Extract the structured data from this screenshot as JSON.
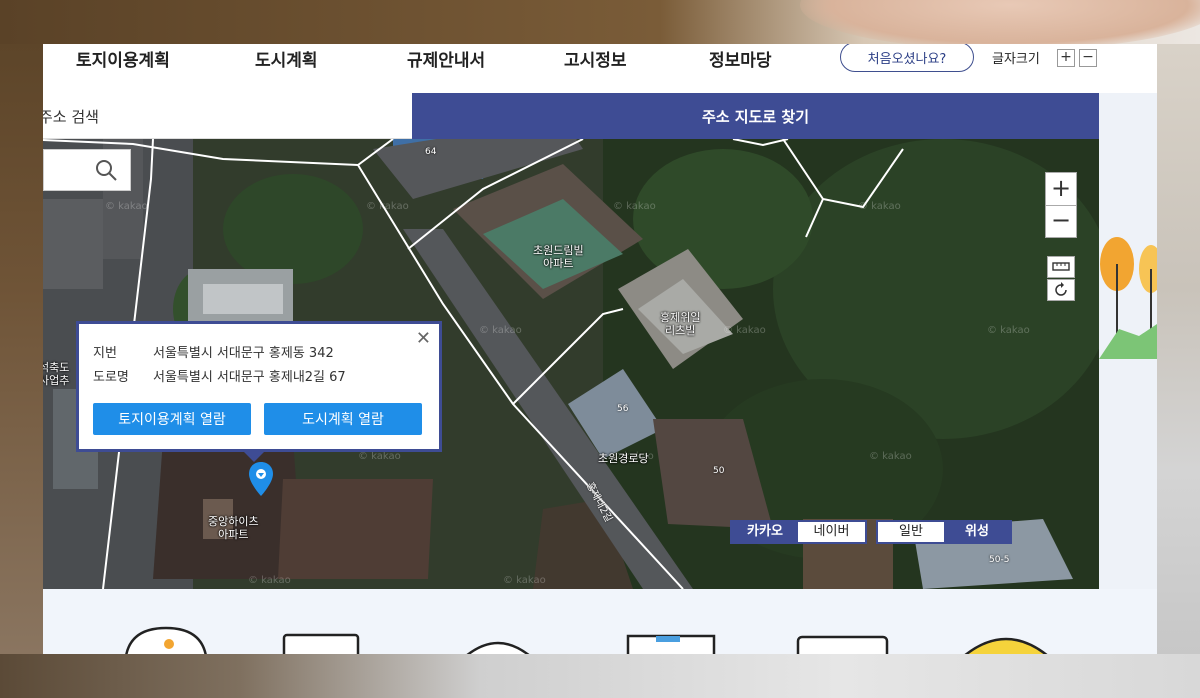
{
  "nav": {
    "items": [
      "토지이용계획",
      "도시계획",
      "규제안내서",
      "고시정보",
      "정보마당"
    ],
    "first_visit": "처음오셨나요?",
    "font_size_label": "글자크기",
    "font_plus": "+",
    "font_minus": "−"
  },
  "tabs": {
    "address_search": "주소 검색",
    "map_find": "주소 지도로 찾기"
  },
  "map": {
    "watermark": "© kakao",
    "labels": {
      "chowon_dreamville": "초원드림빌\n아파트",
      "hongje_wiil": "홍제위일\n리츠빌",
      "chowon_senior": "초원경로당",
      "jungang_heights": "중앙하이츠\n아파트",
      "left_cut": "석축도\n사업추"
    },
    "road_label": "홍제내2길",
    "building_numbers": [
      "64",
      "56",
      "50",
      "50-5"
    ],
    "provider_options": [
      "카카오",
      "네이버"
    ],
    "provider_selected": "카카오",
    "view_options": [
      "일반",
      "위성"
    ],
    "view_selected": "위성",
    "zoom_in": "+",
    "zoom_out": "−"
  },
  "popup": {
    "jibun_label": "지번",
    "jibun_value": "서울특별시 서대문구 홍제동 342",
    "road_label": "도로명",
    "road_value": "서울특별시 서대문구 홍제내2길 67",
    "btn_land": "토지이용계획 열람",
    "btn_city": "도시계획 열람",
    "close": "✕"
  },
  "colors": {
    "primary": "#3e4c94",
    "button_blue": "#1f8ee8"
  }
}
